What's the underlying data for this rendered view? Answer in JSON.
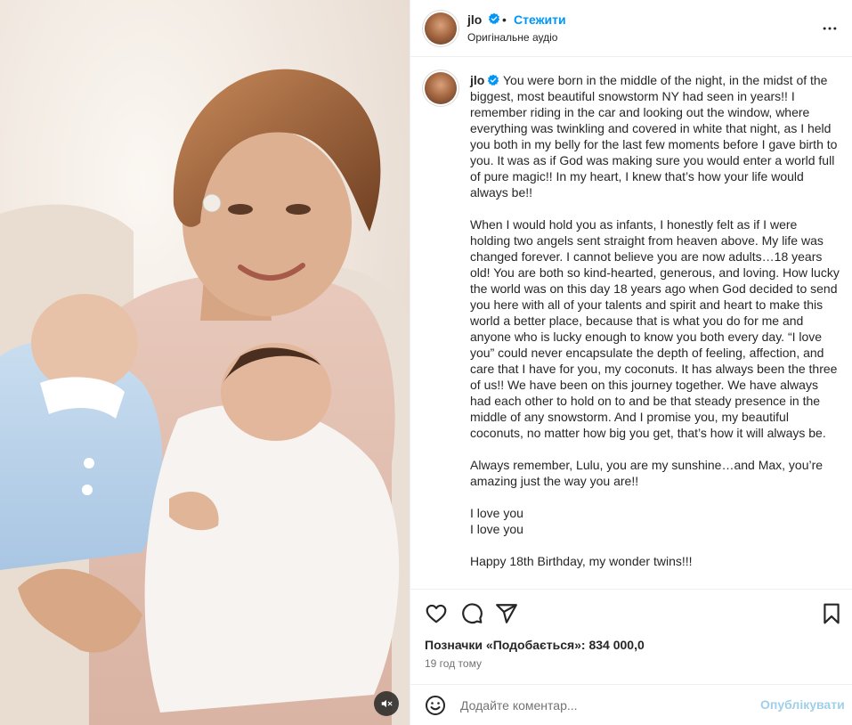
{
  "post": {
    "username": "jlo",
    "follow_label": "Стежити",
    "separator": "•",
    "audio_label": "Оригінальне аудіо"
  },
  "caption": {
    "username": "jlo",
    "paragraphs": [
      "You were born in the middle of the night, in the midst of the biggest, most beautiful snowstorm NY had seen in years!! I remember riding in the car and looking out the window, where everything was twinkling and covered in white that night, as I held you both in my belly for the last few moments before I gave birth to you. It was as if God was making sure you would enter a world full of pure magic!! In my heart, I knew that’s how your life would always be!!",
      "When I would hold you as infants, I honestly felt as if I were holding two angels sent straight from heaven above. My life was changed forever. I cannot believe you are now adults…18 years old! You are both so kind-hearted, generous, and loving. How lucky the world was on this day 18 years ago when God decided to send you here with all of your talents and spirit and heart to make this world a better place, because that is what you do for me and anyone who is lucky enough to know you both every day. “I love you” could never encapsulate the depth of feeling, affection, and care that I have for you, my coconuts. It has always been the three of us!! We have been on this journey together. We have always had each other to hold on to and be that steady presence in the middle of any snowstorm. And I promise you, my beautiful coconuts, no matter how big you get, that’s how it will always be.",
      "Always remember, Lulu, you are my sunshine…and Max, you’re amazing just the way you are!!",
      "I love you",
      "I love you",
      "Happy 18th Birthday, my wonder twins!!!"
    ]
  },
  "stats": {
    "likes_text": "Позначки «Подобається»: 834 000,0",
    "time_ago": "19 год тому"
  },
  "comment": {
    "placeholder": "Додайте коментар...",
    "publish_label": "Опублікувати"
  },
  "colors": {
    "accent": "#0095f6",
    "publish_disabled": "#a0cfe9",
    "verified": "#0095f6"
  },
  "icons": [
    "verified-badge-icon",
    "more-options-icon",
    "heart-icon",
    "comment-icon",
    "share-icon",
    "bookmark-icon",
    "emoji-icon",
    "mute-icon"
  ]
}
